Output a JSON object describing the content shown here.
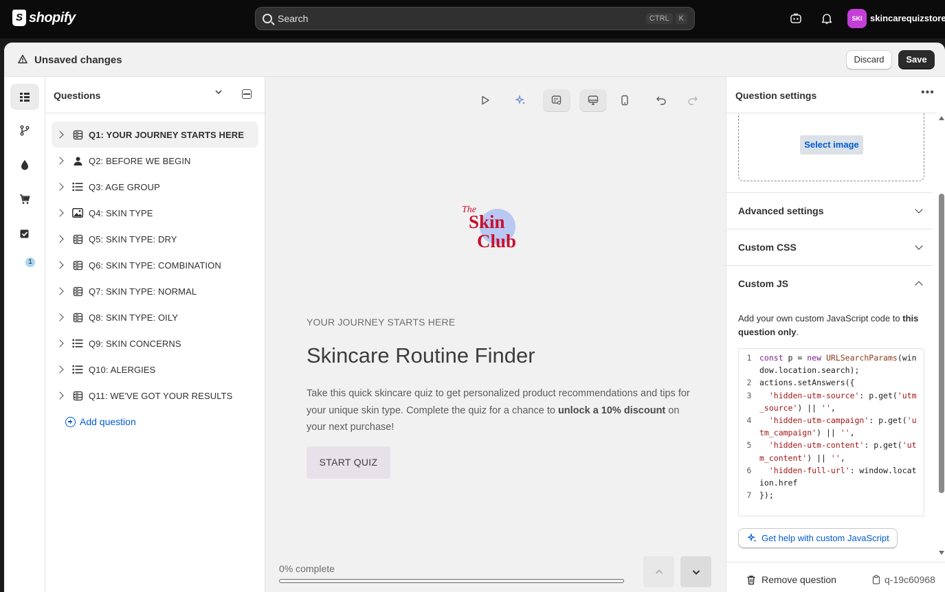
{
  "app": {
    "logo_text": "shopify",
    "search_placeholder": "Search",
    "shortcut_keys": [
      "CTRL",
      "K"
    ],
    "store_initials": "SKI",
    "store_name": "skincarequizstore",
    "store_color": "#c43fd7"
  },
  "unsaved": {
    "title": "Unsaved changes",
    "discard_label": "Discard",
    "save_label": "Save"
  },
  "rail": {
    "items": [
      "list-icon",
      "branch-icon",
      "drop-icon",
      "cart-icon",
      "checklist-icon"
    ],
    "badge": "1"
  },
  "questions": {
    "header": "Questions",
    "items": [
      {
        "label": "Q1: YOUR JOURNEY STARTS HERE",
        "icon": "form-icon"
      },
      {
        "label": "Q2: BEFORE WE BEGIN",
        "icon": "person-icon"
      },
      {
        "label": "Q3: AGE GROUP",
        "icon": "list-icon"
      },
      {
        "label": "Q4: SKIN TYPE",
        "icon": "image-icon"
      },
      {
        "label": "Q5: SKIN TYPE: DRY",
        "icon": "form-icon"
      },
      {
        "label": "Q6: SKIN TYPE: COMBINATION",
        "icon": "form-icon"
      },
      {
        "label": "Q7: SKIN TYPE: NORMAL",
        "icon": "form-icon"
      },
      {
        "label": "Q8: SKIN TYPE: OILY",
        "icon": "form-icon"
      },
      {
        "label": "Q9: SKIN CONCERNS",
        "icon": "list-icon"
      },
      {
        "label": "Q10: ALERGIES",
        "icon": "list-icon"
      },
      {
        "label": "Q11: WE'VE GOT YOUR RESULTS",
        "icon": "form-icon"
      }
    ],
    "add_label": "Add question"
  },
  "preview": {
    "logo_text_the": "The",
    "logo_text_skin": "Skin",
    "logo_text_club": "Club",
    "subtitle": "YOUR JOURNEY STARTS HERE",
    "title": "Skincare Routine Finder",
    "desc_part1": "Take this quick skincare quiz to get personalized product recommendations and tips for your unique skin type. Complete the quiz for a chance to ",
    "desc_bold": "unlock a 10% discount",
    "desc_part2": " on your next purchase!",
    "start_label": "START QUIZ",
    "progress_label": "0% complete",
    "progress_value": 0
  },
  "settings": {
    "title": "Question settings",
    "select_image_label": "Select image",
    "sections": [
      "Advanced settings",
      "Custom CSS",
      "Custom JS"
    ],
    "js_help_1": "Add your own custom JavaScript code to ",
    "js_help_bold": "this question only",
    "js_help_2": ".",
    "code_lines": [
      "1",
      "2",
      "3",
      "4",
      "5",
      "6",
      "7"
    ],
    "help_button": "Get help with custom JavaScript",
    "remove_label": "Remove question",
    "question_id": "q-19c60968"
  }
}
